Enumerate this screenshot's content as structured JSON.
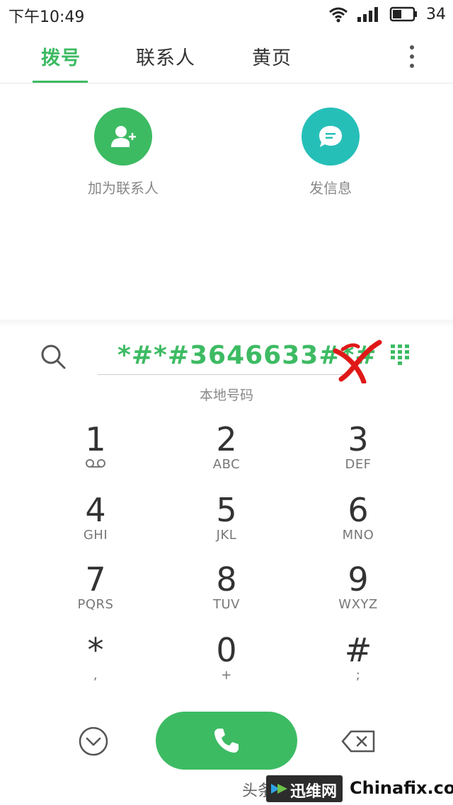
{
  "status_bar": {
    "time": "下午10:49",
    "battery_level": "34"
  },
  "tabs": [
    {
      "label": "拨号",
      "active": true
    },
    {
      "label": "联系人",
      "active": false
    },
    {
      "label": "黄页",
      "active": false
    }
  ],
  "quick_actions": {
    "add_contact": {
      "label": "加为联系人",
      "icon": "add-contact-icon",
      "color": "#3dbb63"
    },
    "send_message": {
      "label": "发信息",
      "icon": "message-icon",
      "color": "#26bfb8"
    }
  },
  "dialer": {
    "number": "*#*#3646633#*#",
    "hint": "本地号码"
  },
  "keypad": [
    {
      "digit": "1",
      "sub": ""
    },
    {
      "digit": "2",
      "sub": "ABC"
    },
    {
      "digit": "3",
      "sub": "DEF"
    },
    {
      "digit": "4",
      "sub": "GHI"
    },
    {
      "digit": "5",
      "sub": "JKL"
    },
    {
      "digit": "6",
      "sub": "MNO"
    },
    {
      "digit": "7",
      "sub": "PQRS"
    },
    {
      "digit": "8",
      "sub": "TUV"
    },
    {
      "digit": "9",
      "sub": "WXYZ"
    },
    {
      "digit": "*",
      "sub": ","
    },
    {
      "digit": "0",
      "sub": "+"
    },
    {
      "digit": "#",
      "sub": ";"
    }
  ],
  "colors": {
    "accent": "#3dbb63",
    "message": "#26bfb8"
  },
  "watermark": {
    "prefix": "头条",
    "logo": "迅维网",
    "site": "Chinafix.com"
  }
}
